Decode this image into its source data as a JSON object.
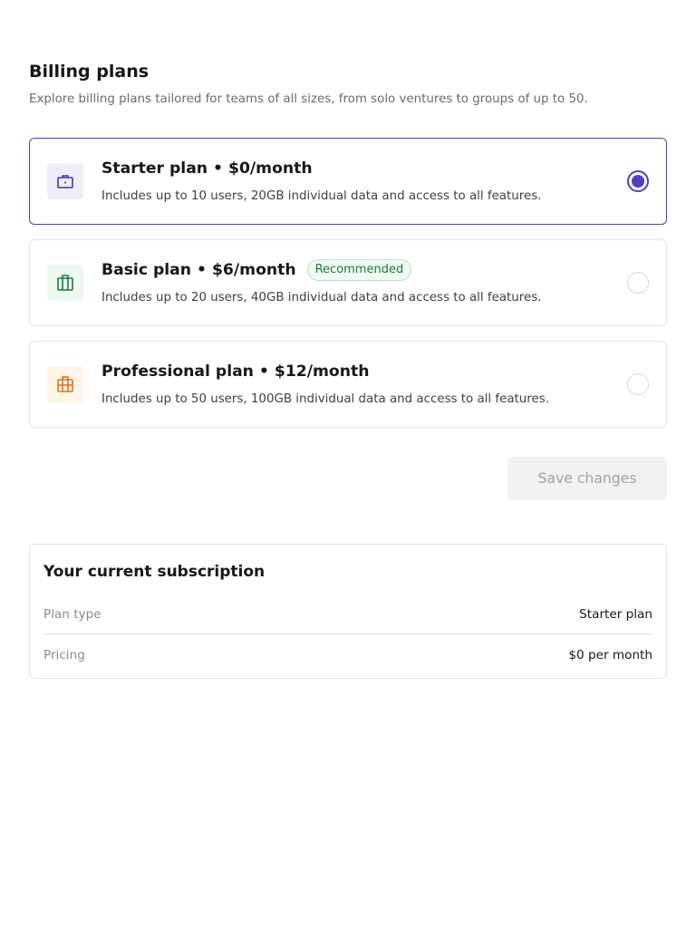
{
  "header": {
    "title": "Billing plans",
    "subtitle": "Explore billing plans tailored for teams of all sizes, from solo ventures to groups of up to 50."
  },
  "plans": [
    {
      "title": "Starter plan • $0/month",
      "description": "Includes up to 10 users, 20GB individual data and access to all features.",
      "icon": "briefcase-icon",
      "icon_color": "#3b3aa8",
      "icon_bg": "#eeeefb",
      "selected": true,
      "badge": ""
    },
    {
      "title": "Basic plan • $6/month",
      "description": "Includes up to 20 users, 40GB individual data and access to all features.",
      "icon": "luggage-icon",
      "icon_color": "#1e7a3c",
      "icon_bg": "#ecf8f0",
      "selected": false,
      "badge": "Recommended"
    },
    {
      "title": "Professional plan • $12/month",
      "description": "Includes up to 50 users, 100GB individual data and access to all features.",
      "icon": "briefcase-grid-icon",
      "icon_color": "#d9761c",
      "icon_bg": "#fdf5e8",
      "selected": false,
      "badge": ""
    }
  ],
  "actions": {
    "save_label": "Save changes"
  },
  "subscription": {
    "title": "Your current subscription",
    "rows": [
      {
        "label": "Plan type",
        "value": "Starter plan"
      },
      {
        "label": "Pricing",
        "value": "$0 per month"
      }
    ]
  },
  "colors": {
    "accent": "#4f3fc4",
    "border": "#e5e5e5",
    "muted_text": "#6b6b6b"
  }
}
